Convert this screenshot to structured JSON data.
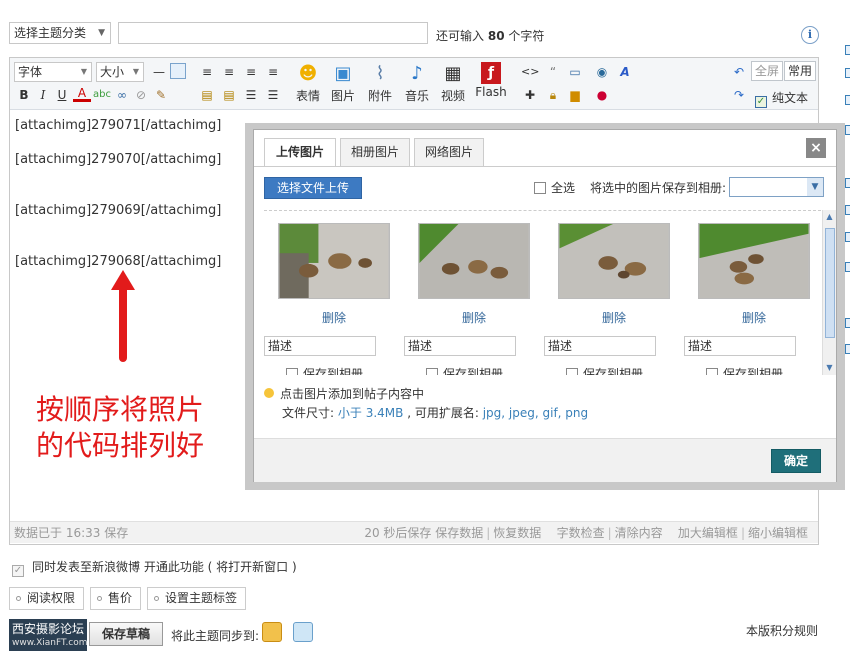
{
  "header": {
    "category_select": "选择主题分类",
    "subject_value": "",
    "char_count_prefix": "还可输入",
    "char_count_number": "80",
    "char_count_suffix": "个字符"
  },
  "toolbar": {
    "font_select": "字体",
    "size_select": "大小",
    "emoticon_label": "表情",
    "image_label": "图片",
    "attachment_label": "附件",
    "music_label": "音乐",
    "video_label": "视频",
    "flash_label": "Flash",
    "fullscreen_label": "全屏",
    "common_label": "常用",
    "plaintext_label": "纯文本"
  },
  "editor": {
    "lines": [
      "[attachimg]279071[/attachimg]",
      "[attachimg]279070[/attachimg]",
      "[attachimg]279069[/attachimg]",
      "[attachimg]279068[/attachimg]"
    ],
    "note_line1": "按顺序将照片",
    "note_line2": "的代码排列好",
    "status_left": "数据已于 16:33 保存",
    "status_autosave": "20 秒后保存 保存数据",
    "status_restore": "恢复数据",
    "status_wordcheck": "字数检查",
    "status_clear": "清除内容",
    "status_enlarge": "加大编辑框",
    "status_shrink": "缩小编辑框"
  },
  "modal": {
    "tabs": [
      "上传图片",
      "相册图片",
      "网络图片"
    ],
    "close": "×",
    "choose_file": "选择文件上传",
    "select_all": "全选",
    "save_to_album": "将选中的图片保存到相册:",
    "album_value": "",
    "photos": [
      {
        "delete": "删除",
        "desc": "描述",
        "save": "保存到相册"
      },
      {
        "delete": "删除",
        "desc": "描述",
        "save": "保存到相册"
      },
      {
        "delete": "删除",
        "desc": "描述",
        "save": "保存到相册"
      },
      {
        "delete": "删除",
        "desc": "描述",
        "save": "保存到相册"
      }
    ],
    "tip": "点击图片添加到帖子内容中",
    "file_size_label": "文件尺寸:",
    "file_size_value": "小于 3.4MB",
    "ext_label": ", 可用扩展名:",
    "ext_value": "jpg, jpeg, gif, png",
    "ok": "确定"
  },
  "footer": {
    "weibo_text": "同时发表至新浪微博 开通此功能 ( 将打开新窗口 )",
    "read_perm": "阅读权限",
    "price": "售价",
    "tags": "设置主题标签",
    "logo_text": "西安摄影论坛",
    "logo_sub": "www.XianFT.com",
    "save_draft": "保存草稿",
    "sync_label": "将此主题同步到:",
    "rules": "本版积分规则"
  },
  "colors": {
    "accent_blue": "#3d7ac2",
    "ok_teal": "#1f6f7a",
    "note_red": "#e21b1b"
  }
}
